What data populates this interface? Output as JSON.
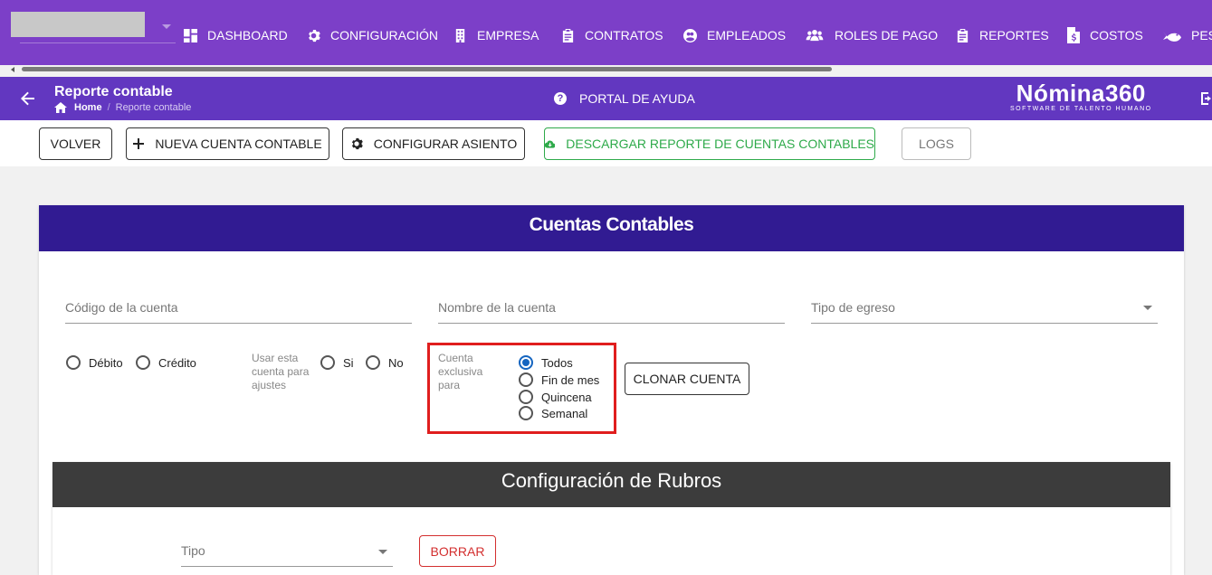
{
  "nav": {
    "items": [
      {
        "label": "DASHBOARD",
        "icon": "dashboard-icon"
      },
      {
        "label": "CONFIGURACIÓN",
        "icon": "gear-icon"
      },
      {
        "label": "EMPRESA",
        "icon": "building-icon"
      },
      {
        "label": "CONTRATOS",
        "icon": "clipboard-icon"
      },
      {
        "label": "EMPLEADOS",
        "icon": "globe-user-icon"
      },
      {
        "label": "ROLES DE PAGO",
        "icon": "users-icon"
      },
      {
        "label": "REPORTES",
        "icon": "clipboard-list-icon"
      },
      {
        "label": "COSTOS",
        "icon": "file-dollar-icon"
      },
      {
        "label": "PES",
        "icon": "fish-icon"
      }
    ]
  },
  "subheader": {
    "title": "Reporte contable",
    "breadcrumb_home": "Home",
    "breadcrumb_current": "Reporte contable",
    "help_label": "PORTAL DE AYUDA",
    "brand_name": "Nómina360",
    "brand_tagline": "SOFTWARE DE TALENTO HUMANO"
  },
  "toolbar": {
    "back_label": "VOLVER",
    "new_account_label": "NUEVA CUENTA CONTABLE",
    "configure_label": "CONFIGURAR ASIENTO",
    "download_label": "DESCARGAR REPORTE DE CUENTAS CONTABLES",
    "logs_label": "LOGS"
  },
  "form": {
    "title": "Cuentas Contables",
    "account_code_placeholder": "Código de la cuenta",
    "account_name_placeholder": "Nombre de la cuenta",
    "expense_type_placeholder": "Tipo de egreso",
    "debit_label": "Débito",
    "credit_label": "Crédito",
    "adjustments_label": "Usar esta cuenta para ajustes",
    "yes_label": "Si",
    "no_label": "No",
    "exclusive_label": "Cuenta exclusiva para",
    "periods": [
      "Todos",
      "Fin de mes",
      "Quincena",
      "Semanal"
    ],
    "selected_period": "Todos",
    "clone_label": "CLONAR CUENTA"
  },
  "rubros": {
    "title": "Configuración de Rubros",
    "type_placeholder": "Tipo",
    "clear_label": "BORRAR"
  },
  "colors": {
    "nav_bg": "#7c3fc8",
    "subheader_bg": "#6237c0",
    "card_header_bg": "#311b92",
    "rubros_header_bg": "#3c3c3c",
    "green": "#2eaa4a",
    "red": "#d32f2f",
    "highlight": "#e01e1e"
  }
}
